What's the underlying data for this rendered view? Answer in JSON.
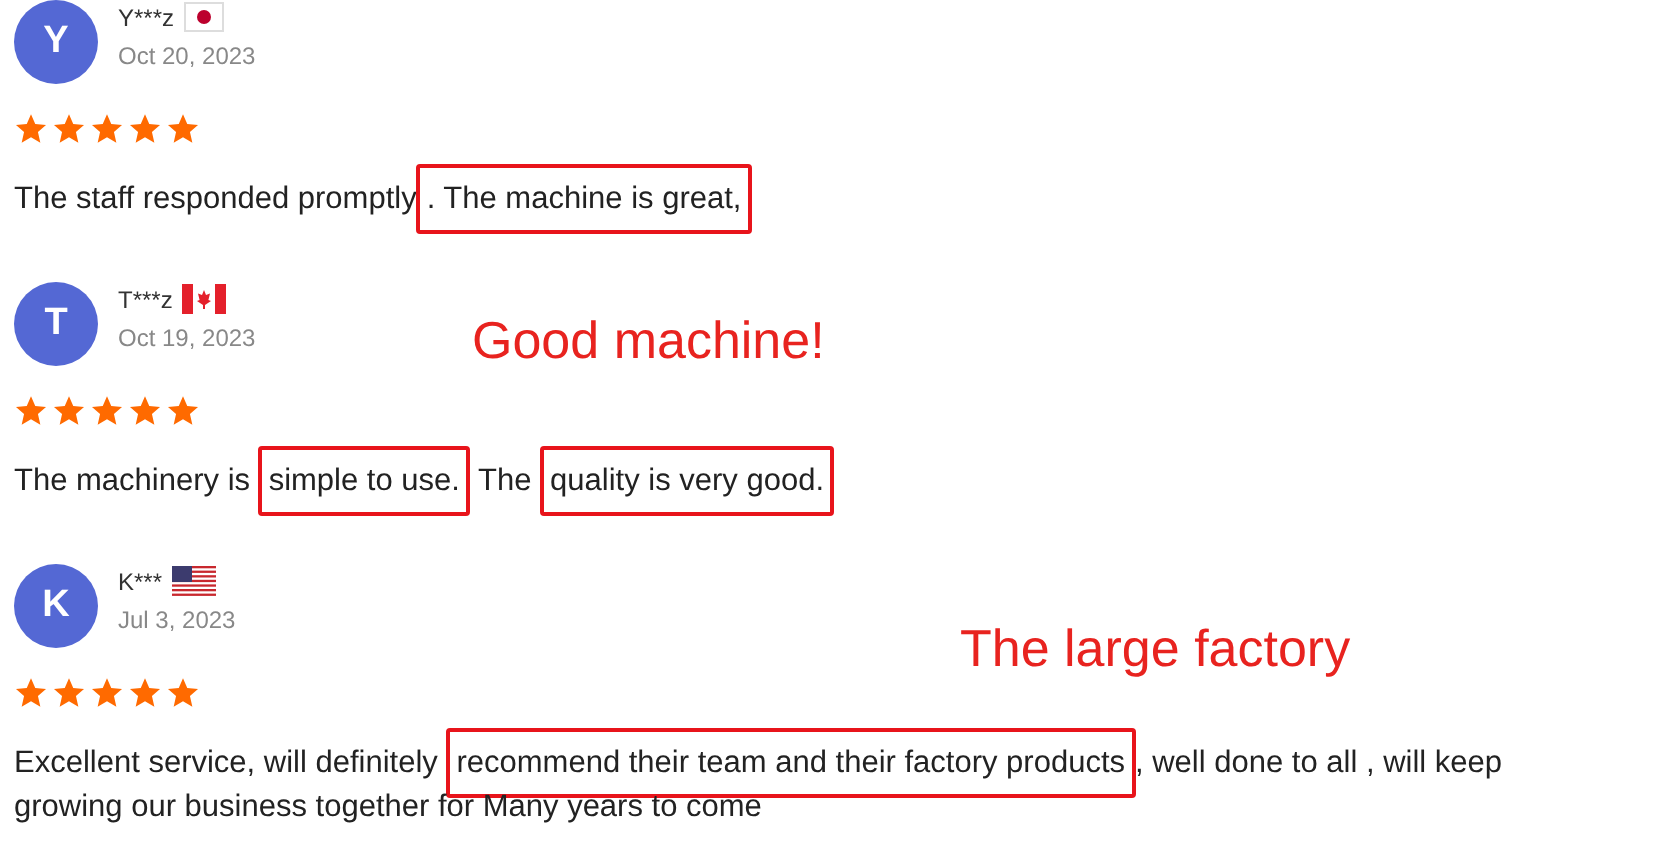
{
  "reviews": [
    {
      "initial": "Y",
      "name": "Y***z",
      "flag": {
        "kind": "japan"
      },
      "date": "Oct 20, 2023",
      "stars": 5,
      "text": [
        {
          "text": "The staff responded promptly",
          "highlighted": false
        },
        {
          "text": ". The machine is great,",
          "highlighted": true
        }
      ]
    },
    {
      "initial": "T",
      "name": "T***z",
      "flag": {
        "kind": "canada"
      },
      "date": "Oct 19, 2023",
      "stars": 5,
      "annotation": "Good machine!",
      "text": [
        {
          "text": "The machinery is ",
          "highlighted": false
        },
        {
          "text": "simple to use.",
          "highlighted": true
        },
        {
          "text": " The ",
          "highlighted": false
        },
        {
          "text": "quality is very good.",
          "highlighted": true
        }
      ]
    },
    {
      "initial": "K",
      "name": "K***",
      "flag": {
        "kind": "usa"
      },
      "date": "Jul 3, 2023",
      "stars": 5,
      "annotation": "The large factory",
      "text": [
        {
          "text": "Excellent service, will definitely ",
          "highlighted": false
        },
        {
          "text": "recommend their team and their factory products",
          "highlighted": true
        },
        {
          "text": ", well done to all , will keep growing our business together for Many years to come",
          "highlighted": false
        }
      ]
    }
  ]
}
